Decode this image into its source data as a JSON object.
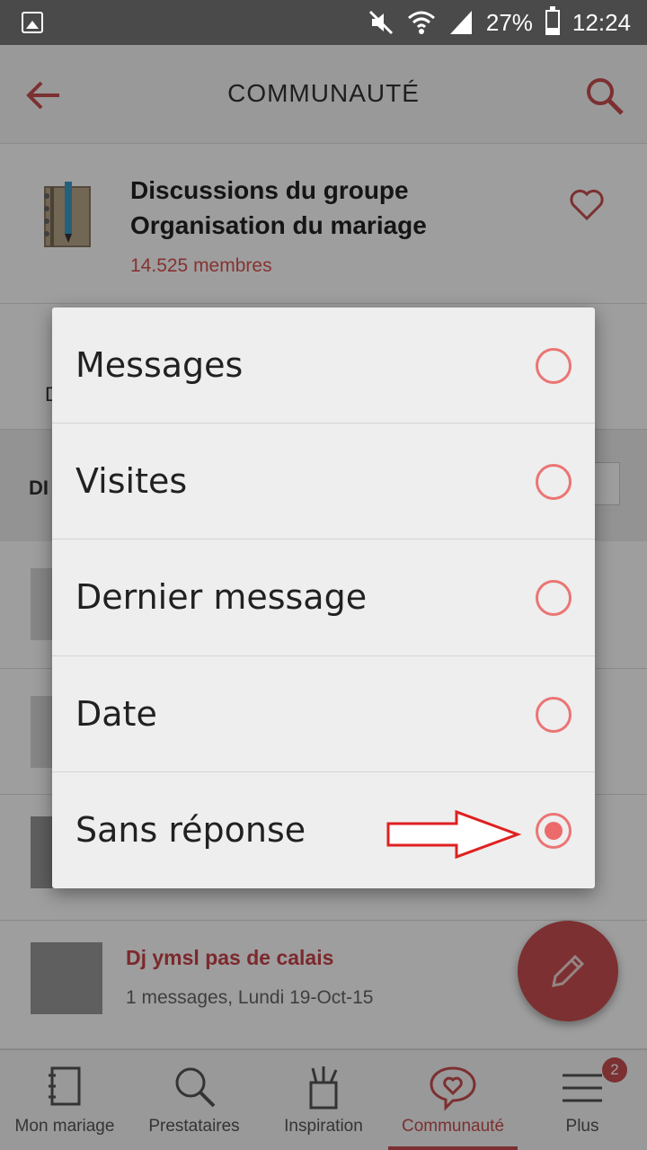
{
  "status_bar": {
    "battery": "27%",
    "battery_level": 0.27,
    "time": "12:24",
    "icons": [
      "gallery-icon",
      "mute-icon",
      "wifi-icon",
      "signal-icon",
      "battery-icon"
    ]
  },
  "app_bar": {
    "title": "COMMUNAUTÉ",
    "back_icon": "arrow-left-icon",
    "search_icon": "search-icon"
  },
  "group": {
    "title": "Discussions du groupe Organisation du mariage",
    "members": "14.525 membres",
    "favorite_icon": "heart-icon"
  },
  "background_list": {
    "tab_hint": "D",
    "sort_hint": "DI",
    "items": [
      {
        "title": "Dj ymsl pas de calais",
        "meta": "1 messages, Lundi 19-Oct-15"
      }
    ]
  },
  "sort_dialog": {
    "options": [
      {
        "label": "Messages",
        "selected": false
      },
      {
        "label": "Visites",
        "selected": false
      },
      {
        "label": "Dernier message",
        "selected": false
      },
      {
        "label": "Date",
        "selected": false
      },
      {
        "label": "Sans réponse",
        "selected": true
      }
    ],
    "annotation": "red-arrow-pointing-to-selected"
  },
  "fab": {
    "icon": "pencil-icon"
  },
  "bottom_nav": {
    "items": [
      {
        "label": "Mon mariage",
        "icon": "notebook-icon",
        "active": false
      },
      {
        "label": "Prestataires",
        "icon": "search-icon",
        "active": false
      },
      {
        "label": "Inspiration",
        "icon": "pencil-cup-icon",
        "active": false
      },
      {
        "label": "Communauté",
        "icon": "heart-bubble-icon",
        "active": true
      },
      {
        "label": "Plus",
        "icon": "menu-icon",
        "active": false,
        "badge": "2"
      }
    ]
  },
  "colors": {
    "accent": "#c84e50",
    "radio": "#ec7474",
    "annotation_arrow": "#e02020"
  }
}
